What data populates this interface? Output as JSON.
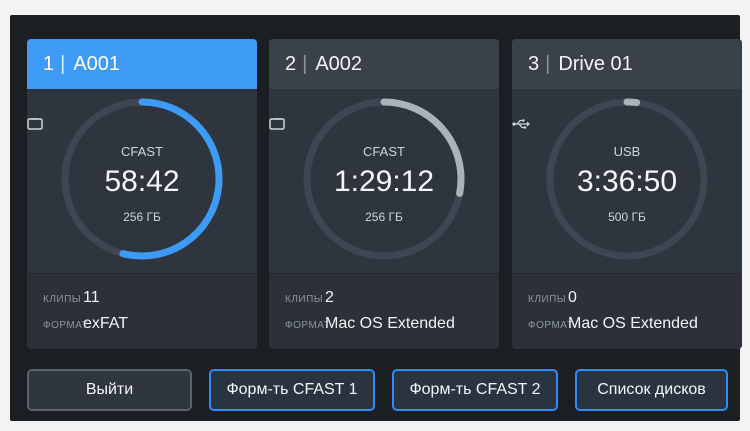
{
  "drives": [
    {
      "index": "1",
      "name": "A001",
      "media_type": "CFAST",
      "media_icon": "card-icon",
      "remaining_time": "58:42",
      "capacity": "256 ГБ",
      "used_fraction": 0.54,
      "selected": true,
      "clips_label": "КЛИПЫ",
      "clips_value": "11",
      "format_label": "ФОРМАТ",
      "format_value": "exFAT"
    },
    {
      "index": "2",
      "name": "A002",
      "media_type": "CFAST",
      "media_icon": "card-icon",
      "remaining_time": "1:29:12",
      "capacity": "256 ГБ",
      "used_fraction": 0.28,
      "selected": false,
      "clips_label": "КЛИПЫ",
      "clips_value": "2",
      "format_label": "ФОРМАТ",
      "format_value": "Mac OS Extended"
    },
    {
      "index": "3",
      "name": "Drive 01",
      "media_type": "USB",
      "media_icon": "usb-icon",
      "remaining_time": "3:36:50",
      "capacity": "500 ГБ",
      "used_fraction": 0.02,
      "selected": false,
      "clips_label": "КЛИПЫ",
      "clips_value": "0",
      "format_label": "ФОРМАТ",
      "format_value": "Mac OS Extended"
    }
  ],
  "buttons": {
    "exit": "Выйти",
    "format_cfast1": "Форм-ть CFAST 1",
    "format_cfast2": "Форм-ть CFAST 2",
    "disk_list": "Список дисков"
  },
  "colors": {
    "selected_arc": "#3d9bf5",
    "unselected_arc": "#aab2bc",
    "track": "#3e4651",
    "button_accent_border": "#2f8cf0"
  }
}
